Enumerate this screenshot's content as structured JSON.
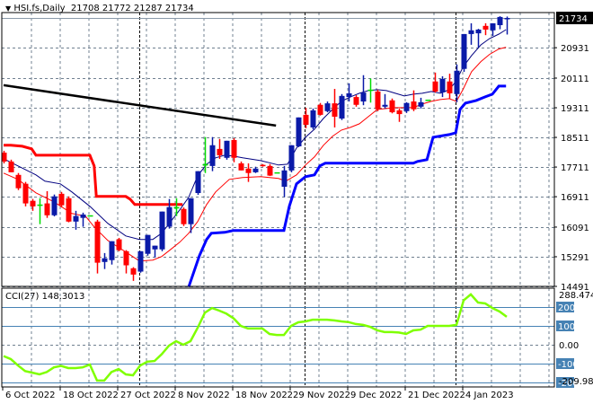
{
  "header": {
    "symbol": "HSI.fs,Daily",
    "ohlc": "21708 21772 21287 21734"
  },
  "price_tag": {
    "value": "21734",
    "bg": "#000000",
    "fg": "#ffffff"
  },
  "colors": {
    "bull": "#0a1aa8",
    "bear": "#ff0000",
    "doji": "#00dd00",
    "ma_fast": "#000080",
    "ma_slow": "#ff0000",
    "stop_lower": "#0000ff",
    "stop_upper": "#ff0000",
    "trendline": "#000000",
    "cci": "#7fff00",
    "cci_level": "#4682b4",
    "grid": "#708090"
  },
  "chart_data": [
    {
      "type": "candlestick",
      "title": "HSI.fs,Daily",
      "ylim": [
        14491,
        21734
      ],
      "y_ticks": [
        "21734",
        "20931",
        "20111",
        "19311",
        "18511",
        "17711",
        "16911",
        "16091",
        "15291",
        "14491"
      ],
      "x_ticks": [
        {
          "label": "6 Oct 2022",
          "index": 0
        },
        {
          "label": "18 Oct 2022",
          "index": 8
        },
        {
          "label": "27 Oct 2022",
          "index": 16
        },
        {
          "label": "8 Nov 2022",
          "index": 24
        },
        {
          "label": "18 Nov 2022",
          "index": 32
        },
        {
          "label": "29 Nov 2022",
          "index": 40
        },
        {
          "label": "9 Dec 2022",
          "index": 48
        },
        {
          "label": "21 Dec 2022",
          "index": 56
        },
        {
          "label": "4 Jan 2023",
          "index": 64
        }
      ],
      "period_separators": [
        18.9,
        41.9,
        62.9
      ],
      "ohlc": [
        [
          18100,
          18150,
          17810,
          17860
        ],
        [
          17860,
          17910,
          17570,
          17570
        ],
        [
          17500,
          17550,
          17090,
          17140
        ],
        [
          17260,
          17310,
          16650,
          16730
        ],
        [
          16800,
          16850,
          16530,
          16650
        ],
        [
          16700,
          16870,
          16170,
          16700
        ],
        [
          16730,
          17060,
          16340,
          16410
        ],
        [
          16410,
          16970,
          16380,
          16920
        ],
        [
          16990,
          17040,
          16620,
          16680
        ],
        [
          16870,
          16920,
          16220,
          16240
        ],
        [
          16240,
          16530,
          16020,
          16390
        ],
        [
          16340,
          16480,
          16100,
          16430
        ],
        [
          16410,
          16430,
          16390,
          16410
        ],
        [
          16240,
          16290,
          14840,
          15130
        ],
        [
          15150,
          15390,
          14960,
          15250
        ],
        [
          15200,
          15710,
          15080,
          15710
        ],
        [
          15760,
          15800,
          15440,
          15470
        ],
        [
          15440,
          15470,
          14840,
          15060
        ],
        [
          14980,
          15010,
          14640,
          14810
        ],
        [
          14890,
          15440,
          14860,
          15440
        ],
        [
          15370,
          15880,
          15320,
          15880
        ],
        [
          15490,
          15590,
          15270,
          15590
        ],
        [
          15490,
          16510,
          15440,
          16510
        ],
        [
          16100,
          16850,
          16050,
          16630
        ],
        [
          16630,
          16870,
          16390,
          16630
        ],
        [
          16580,
          16620,
          16120,
          16170
        ],
        [
          16170,
          16870,
          15930,
          16870
        ],
        [
          17010,
          17600,
          16960,
          17600
        ],
        [
          17790,
          18520,
          17550,
          17790
        ],
        [
          17740,
          18520,
          17600,
          18300
        ],
        [
          18200,
          18470,
          17930,
          18030
        ],
        [
          17960,
          18420,
          17910,
          18420
        ],
        [
          18440,
          18490,
          17840,
          17960
        ],
        [
          17810,
          17860,
          17620,
          17620
        ],
        [
          17670,
          17810,
          17310,
          17550
        ],
        [
          17570,
          17720,
          17550,
          17670
        ],
        [
          17770,
          17790,
          17720,
          17740
        ],
        [
          17740,
          17790,
          17470,
          17480
        ],
        [
          17570,
          17590,
          17550,
          17570
        ],
        [
          17180,
          17740,
          16900,
          17620
        ],
        [
          17620,
          18300,
          17570,
          18300
        ],
        [
          18270,
          19050,
          18250,
          19050
        ],
        [
          19120,
          19310,
          18760,
          18850
        ],
        [
          18780,
          19290,
          18730,
          19240
        ],
        [
          19390,
          19440,
          19100,
          19120
        ],
        [
          19220,
          19480,
          19190,
          19430
        ],
        [
          19430,
          19820,
          18780,
          19070
        ],
        [
          19020,
          19680,
          18980,
          19630
        ],
        [
          19600,
          19970,
          19480,
          19700
        ],
        [
          19600,
          19650,
          19340,
          19390
        ],
        [
          19480,
          20190,
          19380,
          19720
        ],
        [
          19800,
          20100,
          19450,
          19800
        ],
        [
          19750,
          19800,
          19220,
          19270
        ],
        [
          19340,
          19680,
          19290,
          19390
        ],
        [
          19510,
          19560,
          19160,
          19190
        ],
        [
          19240,
          19290,
          18930,
          19140
        ],
        [
          19220,
          19460,
          19170,
          19440
        ],
        [
          19480,
          19780,
          19220,
          19270
        ],
        [
          19340,
          19580,
          19290,
          19460
        ],
        [
          19530,
          19550,
          19510,
          19530
        ],
        [
          20020,
          20260,
          19720,
          19750
        ],
        [
          19725,
          20160,
          19600,
          20090
        ],
        [
          20020,
          20230,
          19560,
          19700
        ],
        [
          19680,
          20480,
          19460,
          20310
        ],
        [
          20360,
          21300,
          20280,
          21300
        ],
        [
          21300,
          21590,
          21010,
          21400
        ],
        [
          21320,
          21440,
          20930,
          21420
        ],
        [
          21520,
          21590,
          21270,
          21420
        ],
        [
          21400,
          21590,
          21250,
          21590
        ],
        [
          21540,
          21780,
          21430,
          21760
        ],
        [
          21708,
          21772,
          21287,
          21734
        ]
      ],
      "overlays": {
        "ma_fast": [
          [
            0,
            17935
          ],
          [
            2,
            17741
          ],
          [
            4.5,
            17499
          ],
          [
            5.75,
            17330
          ],
          [
            7.9,
            17257
          ],
          [
            9.5,
            17039
          ],
          [
            12,
            16652
          ],
          [
            14.5,
            16192
          ],
          [
            17,
            15853
          ],
          [
            18.9,
            15757
          ],
          [
            20.75,
            15757
          ],
          [
            22,
            15926
          ],
          [
            23.25,
            16241
          ],
          [
            24.5,
            16555
          ],
          [
            25.75,
            16894
          ],
          [
            27,
            17475
          ],
          [
            28.25,
            17789
          ],
          [
            29.5,
            17959
          ],
          [
            30.75,
            18031
          ],
          [
            32,
            18007
          ],
          [
            33.25,
            17959
          ],
          [
            35.75,
            17886
          ],
          [
            38.25,
            17765
          ],
          [
            39.5,
            17789
          ],
          [
            40.75,
            18225
          ],
          [
            42,
            18515
          ],
          [
            43.25,
            18733
          ],
          [
            44.5,
            19024
          ],
          [
            45.75,
            19266
          ],
          [
            47,
            19483
          ],
          [
            48.25,
            19604
          ],
          [
            49.5,
            19701
          ],
          [
            50.75,
            19774
          ],
          [
            52,
            19798
          ],
          [
            53.25,
            19774
          ],
          [
            54.5,
            19701
          ],
          [
            55.75,
            19629
          ],
          [
            57,
            19677
          ],
          [
            58.25,
            19701
          ],
          [
            59.5,
            19750
          ],
          [
            60.75,
            19701
          ],
          [
            62,
            19798
          ],
          [
            63,
            20040
          ],
          [
            63.9,
            20403
          ],
          [
            65.1,
            20718
          ],
          [
            66.4,
            21008
          ],
          [
            67.6,
            21177
          ],
          [
            68.9,
            21298
          ],
          [
            69.9,
            21419
          ]
        ],
        "ma_slow": [
          [
            0,
            17547
          ],
          [
            2,
            17378
          ],
          [
            4.5,
            17015
          ],
          [
            7,
            16773
          ],
          [
            9.5,
            16459
          ],
          [
            11.4,
            16386
          ],
          [
            12.6,
            16096
          ],
          [
            14.5,
            15732
          ],
          [
            17,
            15418
          ],
          [
            18.9,
            15176
          ],
          [
            20.75,
            15200
          ],
          [
            22,
            15297
          ],
          [
            23.25,
            15490
          ],
          [
            24.5,
            15684
          ],
          [
            25.75,
            15926
          ],
          [
            27,
            16241
          ],
          [
            28.25,
            16700
          ],
          [
            29.5,
            17039
          ],
          [
            31.4,
            17378
          ],
          [
            33.25,
            17426
          ],
          [
            35.75,
            17451
          ],
          [
            38.25,
            17402
          ],
          [
            39.25,
            17330
          ],
          [
            40.75,
            17499
          ],
          [
            42,
            17765
          ],
          [
            43.25,
            17983
          ],
          [
            44.5,
            18298
          ],
          [
            45.75,
            18540
          ],
          [
            47,
            18709
          ],
          [
            48.25,
            18782
          ],
          [
            49.5,
            18878
          ],
          [
            50.75,
            19072
          ],
          [
            52,
            19266
          ],
          [
            54.5,
            19314
          ],
          [
            57,
            19314
          ],
          [
            58.25,
            19411
          ],
          [
            59.5,
            19483
          ],
          [
            60.75,
            19532
          ],
          [
            62,
            19556
          ],
          [
            63,
            19483
          ],
          [
            63.9,
            19798
          ],
          [
            65.1,
            20282
          ],
          [
            66.4,
            20556
          ],
          [
            67.6,
            20750
          ],
          [
            68.9,
            20895
          ],
          [
            69.9,
            20944
          ]
        ],
        "stop_lower": [
          [
            25.75,
            14474
          ],
          [
            27.25,
            15321
          ],
          [
            28.25,
            15757
          ],
          [
            28.9,
            15926
          ],
          [
            30.75,
            15950
          ],
          [
            32,
            15999
          ],
          [
            39,
            15999
          ],
          [
            39.75,
            16652
          ],
          [
            40.75,
            17257
          ],
          [
            42,
            17451
          ],
          [
            43.25,
            17499
          ],
          [
            44,
            17741
          ],
          [
            44.75,
            17814
          ],
          [
            57,
            17814
          ],
          [
            57.6,
            17862
          ],
          [
            58.9,
            17911
          ],
          [
            59.75,
            18515
          ],
          [
            62,
            18588
          ],
          [
            62.9,
            18636
          ],
          [
            63.5,
            19266
          ],
          [
            64.25,
            19435
          ],
          [
            65.75,
            19508
          ],
          [
            67,
            19604
          ],
          [
            68,
            19677
          ],
          [
            68.9,
            19895
          ],
          [
            69.9,
            19895
          ]
        ],
        "stop_upper": [
          [
            0,
            18298
          ],
          [
            1,
            18298
          ],
          [
            2.6,
            18273
          ],
          [
            3.9,
            18201
          ],
          [
            4.5,
            18031
          ],
          [
            12,
            18031
          ],
          [
            12.6,
            17741
          ],
          [
            12.9,
            16918
          ],
          [
            17,
            16918
          ],
          [
            17.6,
            16846
          ],
          [
            18.25,
            16700
          ],
          [
            24.9,
            16700
          ]
        ],
        "trendline": [
          [
            0,
            19919
          ],
          [
            37.9,
            18830
          ]
        ]
      }
    },
    {
      "type": "line",
      "title": "CCI(27) 148.3013",
      "label": "CCI(27)",
      "last_value": "148.3013",
      "ylim": [
        -209.9873,
        288.4747
      ],
      "y_labels": {
        "max": "288.4747",
        "min": "-209.9873",
        "zero": "0.00"
      },
      "levels": [
        200,
        100,
        -100,
        -200
      ],
      "level_labels": [
        "200",
        "100",
        "-100",
        "-200"
      ],
      "values": [
        -60,
        -76,
        -110,
        -140,
        -148,
        -157,
        -145,
        -120,
        -112,
        -124,
        -124,
        -120,
        -105,
        -190,
        -190,
        -145,
        -129,
        -157,
        -162,
        -110,
        -90,
        -86,
        -50,
        -5,
        19,
        0,
        19,
        90,
        170,
        195,
        181,
        165,
        140,
        100,
        86,
        86,
        86,
        57,
        52,
        52,
        100,
        119,
        124,
        133,
        133,
        133,
        129,
        124,
        120,
        110,
        105,
        95,
        76,
        67,
        67,
        65,
        57,
        76,
        80,
        100,
        100,
        100,
        100,
        105,
        235,
        267,
        224,
        219,
        195,
        176,
        148.3
      ]
    }
  ]
}
